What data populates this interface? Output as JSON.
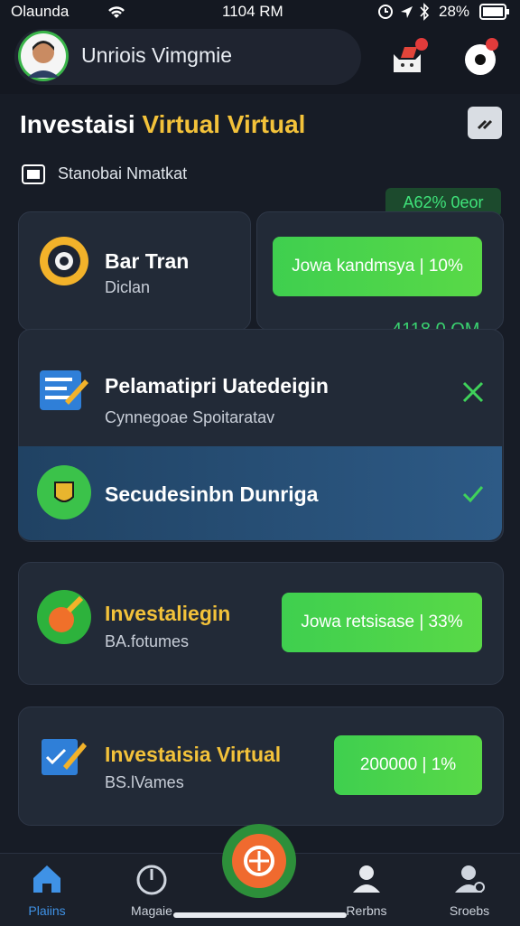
{
  "status_bar": {
    "carrier": "Olaunda",
    "time": "1104 RM",
    "battery": "28%"
  },
  "header": {
    "user_name": "Unriois  Vimgmie"
  },
  "page": {
    "title_part1": "Investaisi ",
    "title_part2": "Virtual Virtual",
    "subtitle": "Stanobai Nmatkat"
  },
  "cards": {
    "top_left": {
      "title": "Bar Tran",
      "subtitle": "Diclan"
    },
    "top_right": {
      "tag": "A62% 0eor",
      "pill": "Jowa kandmsya | 10%",
      "value": "4118 0 OM"
    },
    "list_item_1": {
      "title": "Pelamatipri Uatedeigin",
      "subtitle": "Cynnegoae Spoitaratav"
    },
    "list_item_2": {
      "title": "Secudesinbn Dunriga"
    },
    "invest_1": {
      "title": "Investaliegin",
      "subtitle": "BA.fotumes",
      "pill": "Jowa retsisase | 33%"
    },
    "invest_2": {
      "title": "Investaisia Virtual",
      "subtitle": "BS.lVames",
      "pill": "200000 | 1%"
    }
  },
  "bottom_nav": {
    "items": [
      {
        "label": "Plaiins"
      },
      {
        "label": "Magaie"
      },
      {
        "label": "Rerbns"
      },
      {
        "label": "Sroebs"
      }
    ]
  },
  "colors": {
    "accent_yellow": "#f3c23a",
    "green": "#3fcf4f",
    "highlight_blue": "#2d5a86"
  }
}
